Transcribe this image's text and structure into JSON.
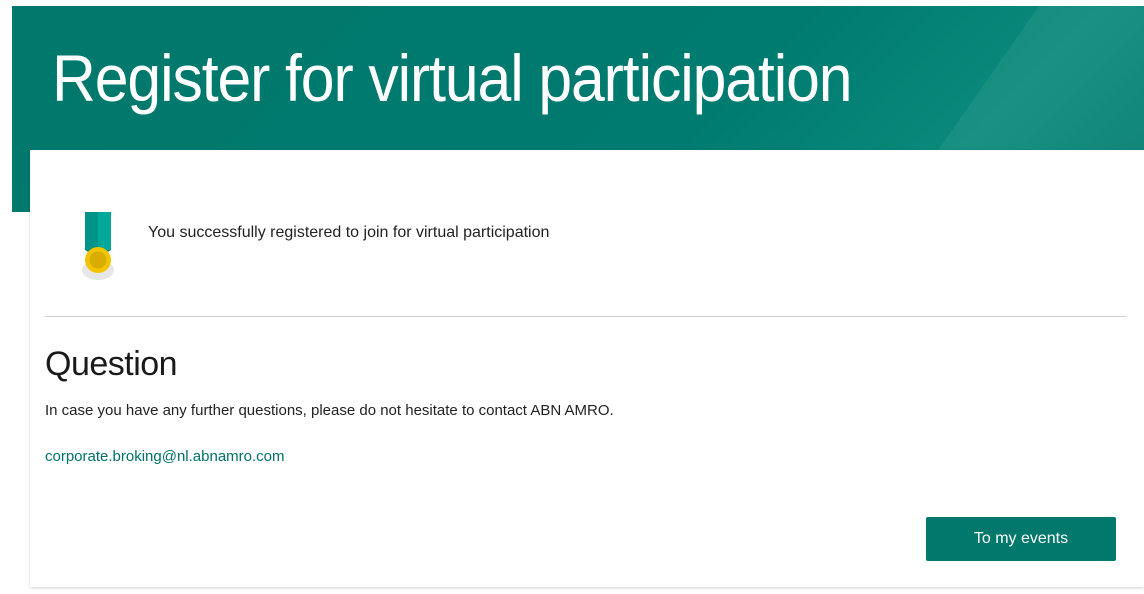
{
  "header": {
    "title": "Register for virtual participation"
  },
  "success": {
    "icon": "medal-icon",
    "message": "You successfully registered to join for virtual participation"
  },
  "question": {
    "heading": "Question",
    "text": "In case you have any further questions, please do not hesitate to contact ABN AMRO.",
    "email": "corporate.broking@nl.abnamro.com"
  },
  "actions": {
    "events_label": "To my events"
  },
  "colors": {
    "brand": "#00786c",
    "link": "#00716a",
    "medal_gold": "#f2c400"
  }
}
